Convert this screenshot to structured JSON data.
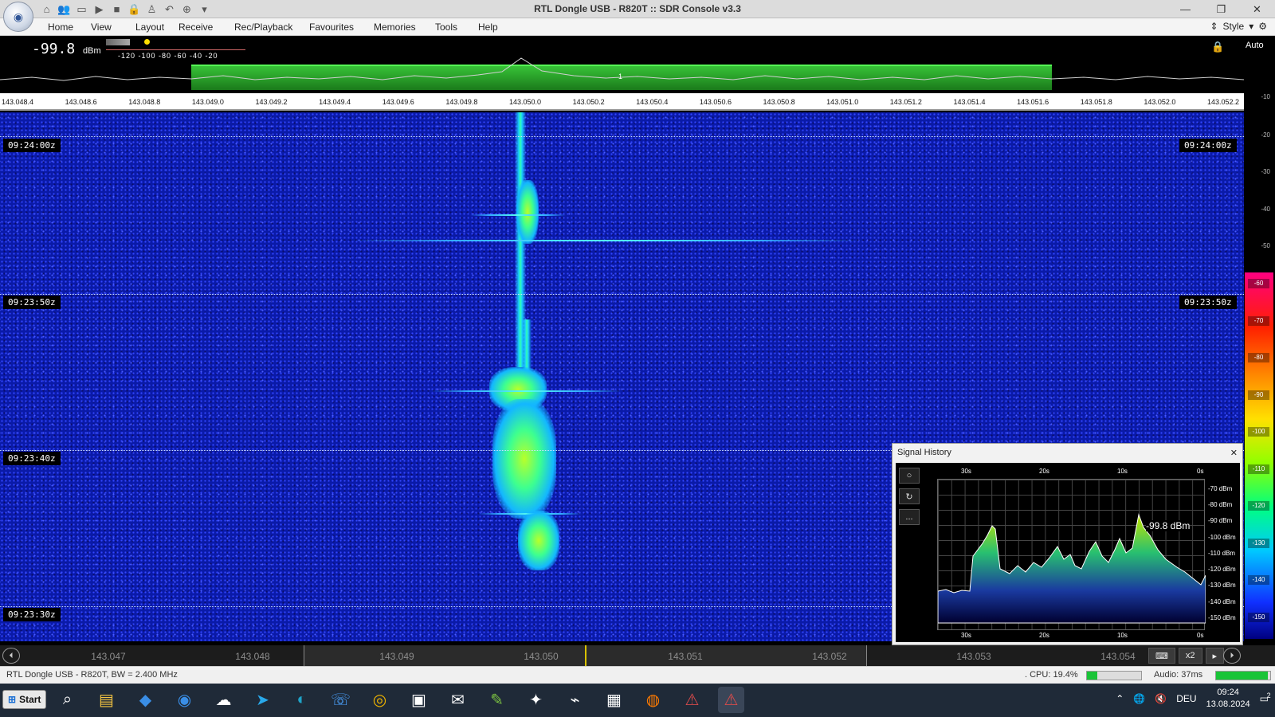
{
  "window": {
    "title": "RTL Dongle USB - R820T :: SDR Console v3.3",
    "minimize": "—",
    "maximize": "❐",
    "close": "✕"
  },
  "quick_access": [
    "home-icon",
    "users-icon",
    "folder-icon",
    "play-icon",
    "stop-icon",
    "lock-icon",
    "person-icon",
    "undo-icon",
    "add-icon",
    "dropdown-icon"
  ],
  "menu": [
    "Home",
    "View",
    "Layout",
    "Receive",
    "Rec/Playback",
    "Favourites",
    "Memories",
    "Tools",
    "Help"
  ],
  "style_menu": "Style",
  "signal": {
    "value": "-99.8",
    "unit": "dBm",
    "scale": "-120 -100 -80 -60 -40 -20",
    "channel_marker": "1"
  },
  "freq_axis": [
    "143.048.4",
    "143.048.6",
    "143.048.8",
    "143.049.0",
    "143.049.2",
    "143.049.4",
    "143.049.6",
    "143.049.8",
    "143.050.0",
    "143.050.2",
    "143.050.4",
    "143.050.6",
    "143.050.8",
    "143.051.0",
    "143.051.2",
    "143.051.4",
    "143.051.6",
    "143.051.8",
    "143.052.0",
    "143.052.2"
  ],
  "time_marks": [
    "09:24:00z",
    "09:23:50z",
    "09:23:40z",
    "09:23:30z"
  ],
  "db_scale": {
    "auto_label": "Auto",
    "ticks": [
      "-10",
      "-20",
      "-30",
      "-40",
      "-50"
    ],
    "color_ticks": [
      "-60",
      "-70",
      "-80",
      "-90",
      "-100",
      "-110",
      "-120",
      "-130",
      "-140",
      "-150"
    ]
  },
  "signal_history": {
    "title": "Signal History",
    "close": "✕",
    "time_labels": [
      "30s",
      "20s",
      "10s",
      "0s"
    ],
    "db_labels": [
      "-70 dBm",
      "-80 dBm",
      "-90 dBm",
      "-100 dBm",
      "-110 dBm",
      "-120 dBm",
      "-130 dBm",
      "-140 dBm",
      "-150 dBm"
    ],
    "readout": "-99.8 dBm",
    "buttons": [
      "○",
      "↻",
      "..."
    ]
  },
  "bottom_scale": {
    "labels": [
      "143.047",
      "143.048",
      "143.049",
      "143.050",
      "143.051",
      "143.052",
      "143.053",
      "143.054"
    ],
    "zoom": "x2"
  },
  "status": {
    "device": "RTL Dongle USB - R820T, BW = 2.400 MHz",
    "cpu": ". CPU: 19.4%",
    "cpu_level": 0.194,
    "audio": "Audio: 37ms",
    "audio_level": 0.95
  },
  "taskbar": {
    "start": "Start",
    "icons": [
      "search-icon",
      "explorer-icon",
      "vs-code-icon",
      "browser-icon",
      "weather-icon",
      "telegram-icon",
      "edge-icon",
      "phone-icon",
      "chrome-icon",
      "remote-icon",
      "chat-icon",
      "notepad-icon",
      "compass-icon",
      "antenna-icon",
      "app-icon",
      "firefox-icon",
      "sdr-icon",
      "sdr-active-icon"
    ],
    "language": "DEU",
    "time": "09:24",
    "date": "13.08.2024",
    "notification_count": "2"
  }
}
